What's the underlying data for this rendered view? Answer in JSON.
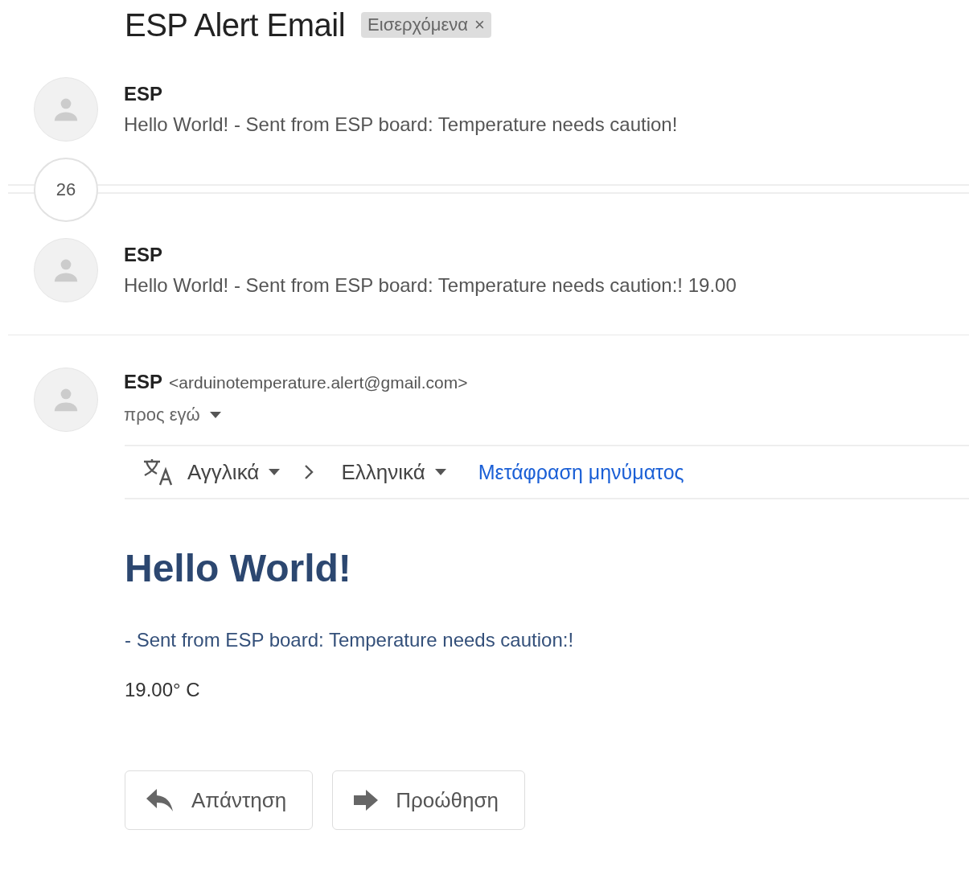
{
  "subject": "ESP Alert Email",
  "label": {
    "text": "Εισερχόμενα",
    "close": "×"
  },
  "thread": [
    {
      "kind": "message",
      "sender": "ESP",
      "snippet": "Hello World! - Sent from ESP board: Temperature needs caution!"
    },
    {
      "kind": "collapsed",
      "count": "26"
    },
    {
      "kind": "message",
      "sender": "ESP",
      "snippet": "Hello World! - Sent from ESP board: Temperature needs caution:! 19.00"
    }
  ],
  "open_message": {
    "sender": "ESP",
    "address": "<arduinotemperature.alert@gmail.com>",
    "recipient": "προς εγώ",
    "translate": {
      "from": "Αγγλικά",
      "to": "Ελληνικά",
      "action": "Μετάφραση μηνύματος"
    },
    "heading": "Hello World!",
    "paragraphs": [
      {
        "kind": "accent",
        "text": "- Sent from ESP board: Temperature needs caution:!"
      },
      {
        "kind": "plain",
        "text": "19.00° C"
      }
    ]
  },
  "actions": [
    {
      "kind": "reply",
      "label": "Απάντηση"
    },
    {
      "kind": "forward",
      "label": "Προώθηση"
    }
  ]
}
